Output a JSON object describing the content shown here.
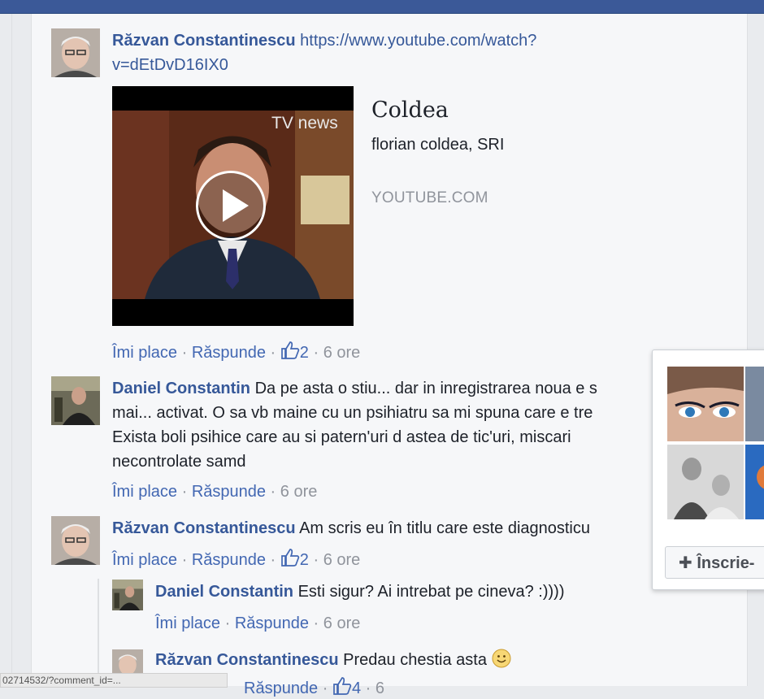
{
  "comments": [
    {
      "author": "Răzvan Constantinescu",
      "text_line1": "https://www.youtube.com/watch?",
      "text_line2": "v=dEtDvD16IX0",
      "like": "Îmi place",
      "reply": "Răspunde",
      "likes": "2",
      "time": "6 ore"
    },
    {
      "author": "Daniel Constantin",
      "text_line1": "Da pe asta o stiu... dar in inregistrarea noua e s",
      "text_line2": "mai... activat. O sa vb maine cu un psihiatru sa mi spuna care e tre",
      "text_line3": "Exista boli psihice care au si patern'uri d astea de tic'uri, miscari",
      "text_line4": "necontrolate samd",
      "like": "Îmi place",
      "reply": "Răspunde",
      "time": "6 ore"
    },
    {
      "author": "Răzvan Constantinescu",
      "text_line1": "Am scris eu în titlu care este diagnosticu",
      "like": "Îmi place",
      "reply": "Răspunde",
      "likes": "2",
      "time": "6 ore"
    }
  ],
  "replies": [
    {
      "author": "Daniel Constantin",
      "text": "Esti sigur? Ai intrebat pe cineva? :))))",
      "like": "Îmi place",
      "reply": "Răspunde",
      "time": "6 ore"
    },
    {
      "author": "Răzvan Constantinescu",
      "text": "Predau chestia asta",
      "reply": "Răspunde",
      "likes": "4",
      "time": "6"
    }
  ],
  "link_card": {
    "title": "Coldea",
    "description": "florian coldea, SRI",
    "domain": "YOUTUBE.COM",
    "video_watermark": "TV news"
  },
  "popup": {
    "join_label": "Înscrie-"
  },
  "status_bar": {
    "url": "02714532/?comment_id=..."
  },
  "colors": {
    "topbar": "#3b5998",
    "author": "#365899",
    "action_link": "#4267b2",
    "muted": "#90949c"
  }
}
